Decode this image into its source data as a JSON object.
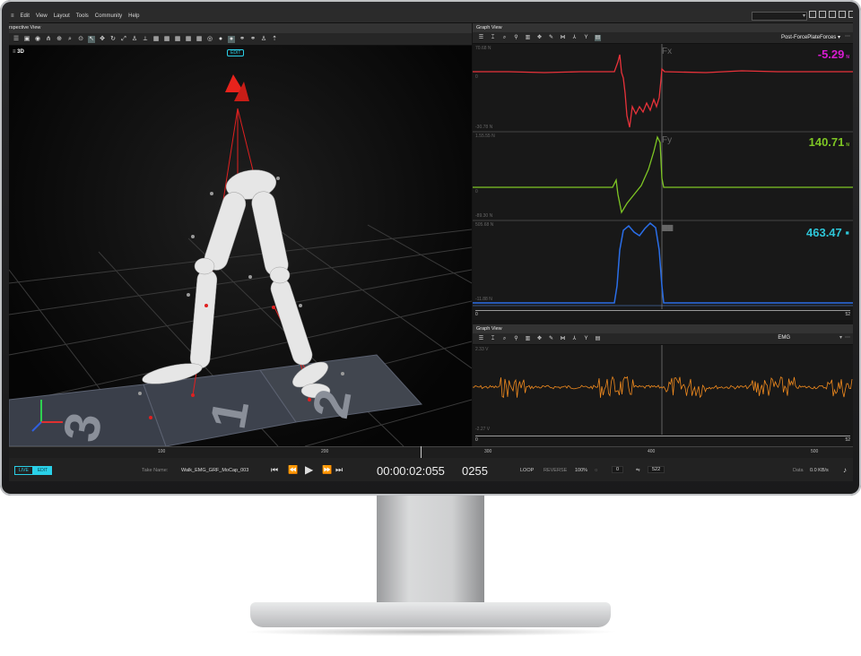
{
  "menu": {
    "items": [
      "Edit",
      "View",
      "Layout",
      "Tools",
      "Community",
      "Help"
    ]
  },
  "perspective": {
    "title": "rspective View",
    "view_label": "3D",
    "edit_badge": "EDIT",
    "floor_markers": [
      "3",
      "1",
      "2"
    ]
  },
  "graph_top": {
    "title": "Graph View",
    "selector": "Post-ForcePlateForces ▾",
    "channels": [
      {
        "name": "Fx",
        "value": "-5.29",
        "unit": "N",
        "color": "#d81bd1",
        "y_top": "70.68 N",
        "y_mid": "0",
        "y_bot": "-30.78 N"
      },
      {
        "name": "Fy",
        "value": "140.71",
        "unit": "N",
        "color": "#7ec624",
        "y_top": "1.55.55 N",
        "y_mid": "0",
        "y_bot": "-89.30 N"
      },
      {
        "name": "Fz",
        "value": "463.47",
        "unit": "N",
        "color": "#2ec6d8",
        "y_top": "505.68 N",
        "y_mid": "",
        "y_bot": "-11.88 N"
      }
    ],
    "x_start": "0",
    "x_end": "52"
  },
  "graph_bottom": {
    "title": "Graph View",
    "selector": "EMG",
    "y_top": "2.33 V",
    "y_bot": "-2.27 V",
    "x_start": "0",
    "x_end": "52"
  },
  "timeline": {
    "marks": [
      "100",
      "200",
      "300",
      "400",
      "500"
    ]
  },
  "transport": {
    "live": "LIVE",
    "edit": "EDIT",
    "take_label": "Take Name:",
    "take_name": "Walk_EMG_GRF_MoCap_003",
    "timecode": "00:00:02:055",
    "frame": "0255",
    "loop": "LOOP",
    "reverse": "REVERSE",
    "speed": "100%",
    "range_start": "0",
    "range_end": "522",
    "data_label": "Data",
    "data_rate": "0.0 KB/s"
  },
  "colors": {
    "accent": "#2ad0e8",
    "fx": "#e8323a",
    "fy": "#7ec624",
    "fz": "#2a6ee8",
    "emg": "#f08a1e"
  },
  "icons": [
    "menu-icon",
    "camera-icon",
    "play-icon",
    "skip-back-icon",
    "skip-forward-icon",
    "bell-icon",
    "search-icon",
    "move-icon",
    "rotate-icon"
  ]
}
